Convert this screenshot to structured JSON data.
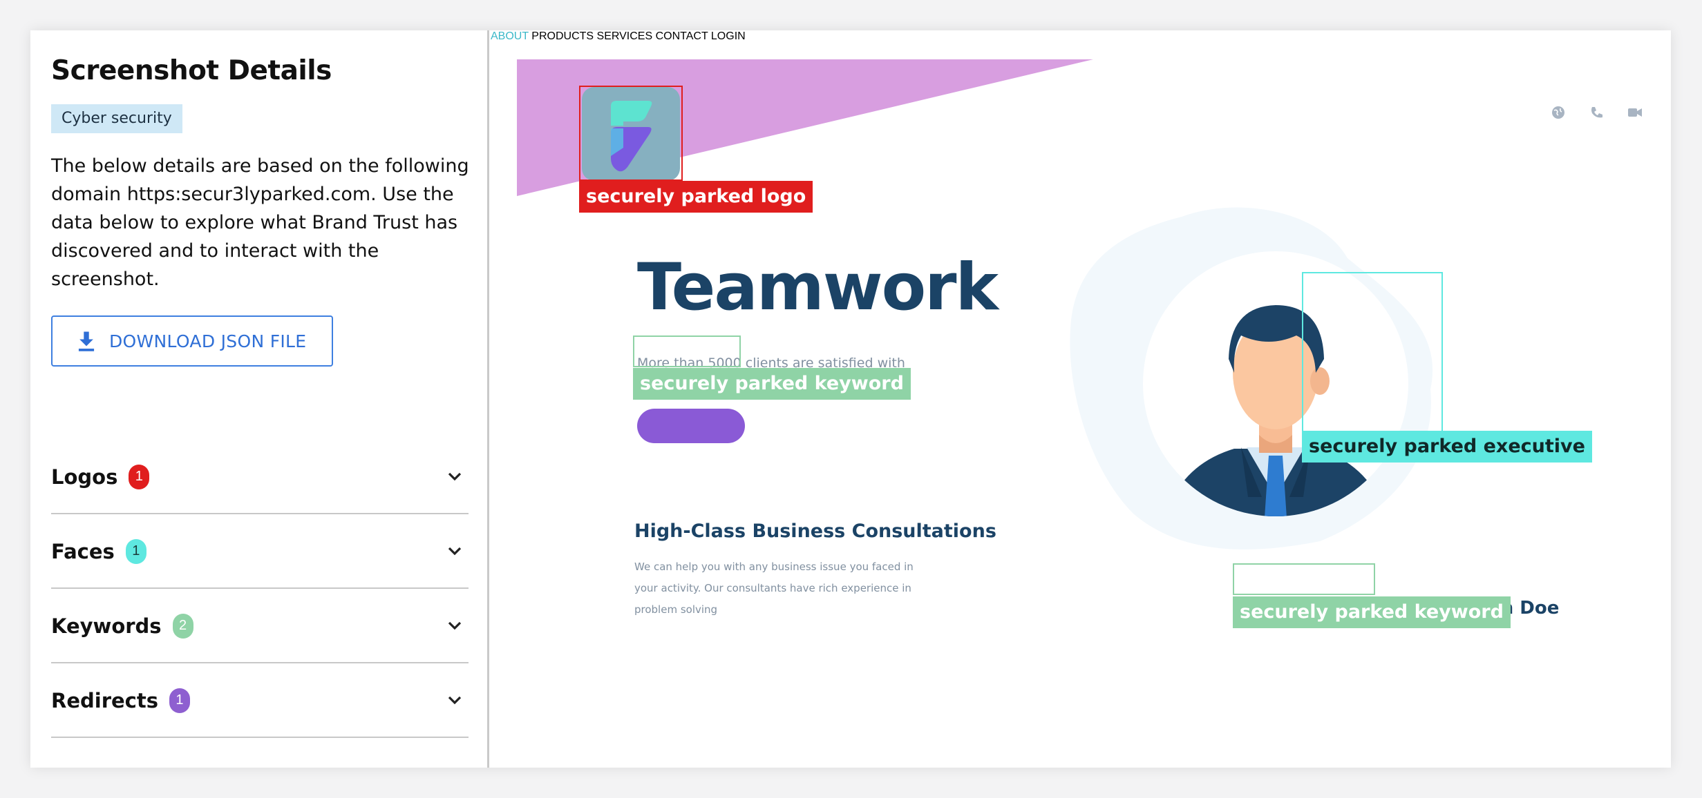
{
  "panel": {
    "title": "Screenshot Details",
    "tag": "Cyber security",
    "description": "The below details are based on the following domain https:secur3lyparked.com. Use the data below to explore what Brand Trust has discovered and to interact with the screenshot.",
    "download_label": "DOWNLOAD JSON FILE",
    "sections": [
      {
        "label": "Logos",
        "count": "1",
        "badge_bg": "#e01e1e",
        "badge_fg": "#ffffff"
      },
      {
        "label": "Faces",
        "count": "1",
        "badge_bg": "#5ee8e0",
        "badge_fg": "#1a3a3a"
      },
      {
        "label": "Keywords",
        "count": "2",
        "badge_bg": "#8fd3a6",
        "badge_fg": "#ffffff"
      },
      {
        "label": "Redirects",
        "count": "1",
        "badge_bg": "#8e5fd0",
        "badge_fg": "#ffffff"
      }
    ]
  },
  "site": {
    "nav": [
      "ABOUT",
      "PRODUCTS",
      "SERVICES",
      "CONTACT",
      "LOGIN"
    ],
    "nav_active_color": "#3bb8c8",
    "hero_title": "Teamwork",
    "hero_subtitle": "More than 5000 clients are satisfied with Securely Parked's consulting program",
    "section_title": "High-Class Business Consultations",
    "section_text": "We can help you with any business issue you faced in your activity. Our consultants have rich experience in problem solving",
    "ceo_caption": "Securely Parked's CEO John Doe"
  },
  "annotations": {
    "logo_label": "securely parked logo",
    "executive_label": "securely parked executive",
    "keyword_label_1": "securely parked keyword",
    "keyword_label_2": "securely parked keyword",
    "colors": {
      "logo": "#e01e1e",
      "executive": "#5ee8e0",
      "keyword": "#8fd3a6"
    }
  }
}
